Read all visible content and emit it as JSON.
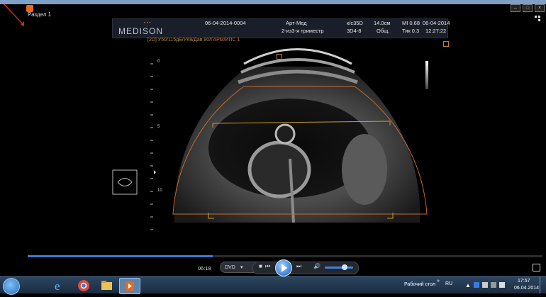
{
  "window": {
    "title": "Раздел 1"
  },
  "scan_header": {
    "brand": "MEDISON",
    "study_id": "06-04-2014-0004",
    "clinic": "Арт-Мед",
    "exam": "2-из3-я триместр",
    "frame_rate_label": "к/с35D",
    "probe": "3D4-8",
    "depth": "14.0см",
    "preset": "Общ.",
    "mi": "MI 0.68",
    "tis": "Тик 0.3",
    "date": "06-04-2014",
    "time": "12:27:22"
  },
  "scan_params": {
    "normal": "[2D] У50/115дБ/УК8/Дав.90/",
    "highlight": "ГАРМ/ИПС 1"
  },
  "depth_scale": {
    "labels": [
      "0",
      "5",
      "10"
    ]
  },
  "player": {
    "elapsed": "06:18",
    "source": "DVD",
    "progress_fraction": 0.36,
    "volume_fraction": 0.7
  },
  "taskbar": {
    "desktop_label": "Рабочий стол",
    "language": "RU",
    "clock_time": "17:57",
    "clock_date": "06.04.2014"
  },
  "colors": {
    "accent": "#3d78d8",
    "fan": "#c86a2a",
    "caliper": "#c8a02a"
  }
}
